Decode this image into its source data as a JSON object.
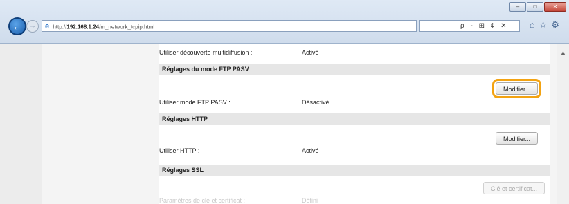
{
  "browser": {
    "address_prefix": "http://",
    "address_host": "192.168.1.24",
    "address_path": "/m_network_tcpip.html",
    "tools": "ρ - ⊞ ¢ ✕"
  },
  "page": {
    "multicast_label": "Utiliser découverte multidiffusion :",
    "multicast_value": "Activé",
    "ftp_header": "Réglages du mode FTP PASV",
    "ftp_modify": "Modifier...",
    "ftp_label": "Utiliser mode FTP PASV :",
    "ftp_value": "Désactivé",
    "http_header": "Réglages HTTP",
    "http_modify": "Modifier...",
    "http_label": "Utiliser HTTP :",
    "http_value": "Activé",
    "ssl_header": "Réglages SSL",
    "ssl_button": "Clé et certificat...",
    "faded_label": "Paramètres de clé et certificat :",
    "faded_value": "Défini"
  },
  "colors": {
    "highlight": "#f3a312",
    "section_bg": "#e6e6e6"
  }
}
